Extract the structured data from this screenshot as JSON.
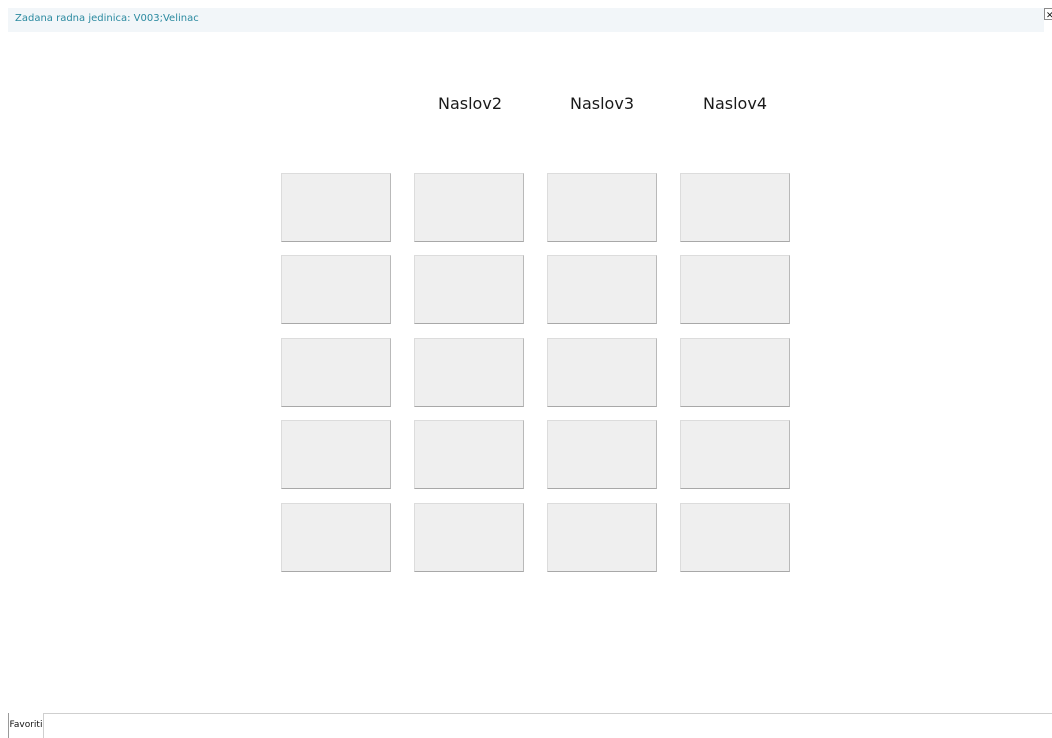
{
  "window": {
    "title": "Zadana radna jedinica: V003;Velinac",
    "close_label": "✕"
  },
  "columns": {
    "headers": [
      "Naslov2",
      "Naslov3",
      "Naslov4"
    ]
  },
  "grid": {
    "rows": 5,
    "cols": 4
  },
  "bottom_tabs": [
    "Favoriti"
  ]
}
